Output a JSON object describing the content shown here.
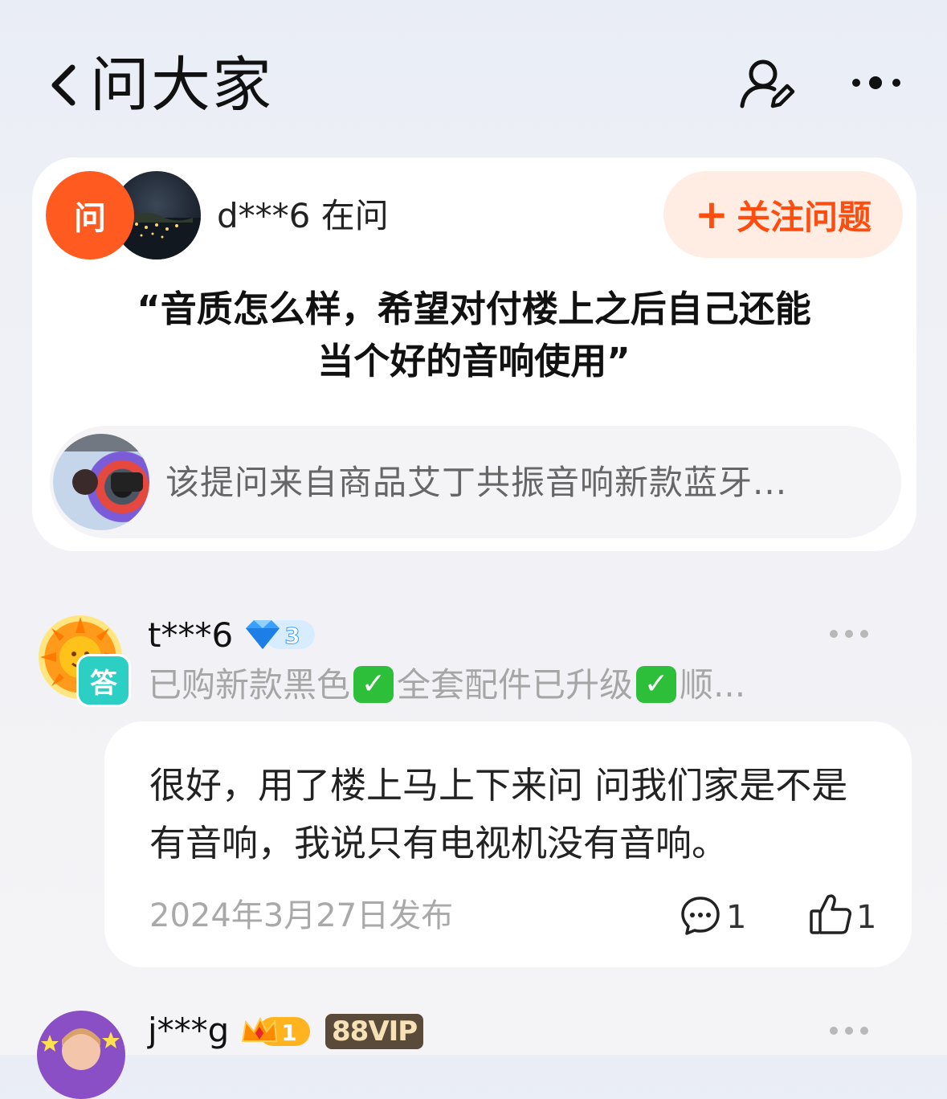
{
  "header": {
    "title": "问大家"
  },
  "question_card": {
    "badge": "问",
    "asker": "d***6 在问",
    "follow_label": "关注问题",
    "question_text": "“音质怎么样，希望对付楼上之后自己还能当个好的音响使用”",
    "source_text": "该提问来自商品艾丁共振音响新款蓝牙..."
  },
  "answers": [
    {
      "badge": "答",
      "user": "t***6",
      "level": "3",
      "tags_part1": "已购新款黑色",
      "tags_part2": "全套配件已升级",
      "tags_part3": "顺...",
      "content": "很好，用了楼上马上下来问 问我们家是不是有音响，我说只有电视机没有音响。",
      "date": "2024年3月27日发布",
      "comment_count": "1",
      "like_count": "1"
    },
    {
      "user": "j***g",
      "level": "1",
      "vip": "88VIP"
    }
  ],
  "colors": {
    "accent": "#ff5a1f",
    "follow_bg": "#ffece3",
    "answer_badge": "#2ccfc3",
    "check_green": "#2dbe3a"
  }
}
